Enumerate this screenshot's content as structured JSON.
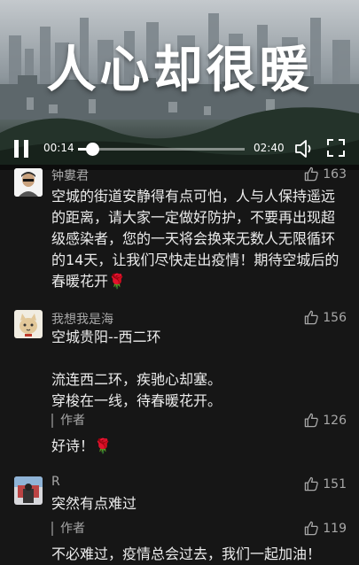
{
  "video": {
    "overlay_title": "人心却很暖",
    "current_time": "00:14",
    "total_time": "02:40",
    "progress": 0.0875
  },
  "comments": [
    {
      "username": "钟婁君",
      "likes": "163",
      "lines": [
        "空城的街道安静得有点可怕，人与人保持遥远",
        "的距离，请大家一定做好防护，不要再出现超",
        "级感染者，您的一天将会换来无数人无限循环",
        "的14天，让我们尽快走出疫情！期待空城后的",
        "春暖花开🌹"
      ]
    },
    {
      "username": "我想我是海",
      "likes": "156",
      "lines": [
        "空城贵阳--西二环",
        "",
        "流连西二环，疾驰心却塞。",
        "穿梭在一线，待春暖花开。"
      ],
      "author_reply": {
        "label": "作者",
        "likes": "126",
        "text": "好诗！🌹"
      }
    },
    {
      "username": "R",
      "likes": "151",
      "lines": [
        "突然有点难过"
      ],
      "author_reply": {
        "label": "作者",
        "likes": "119",
        "text": "不必难过，疫情总会过去，我们一起加油！"
      }
    }
  ]
}
